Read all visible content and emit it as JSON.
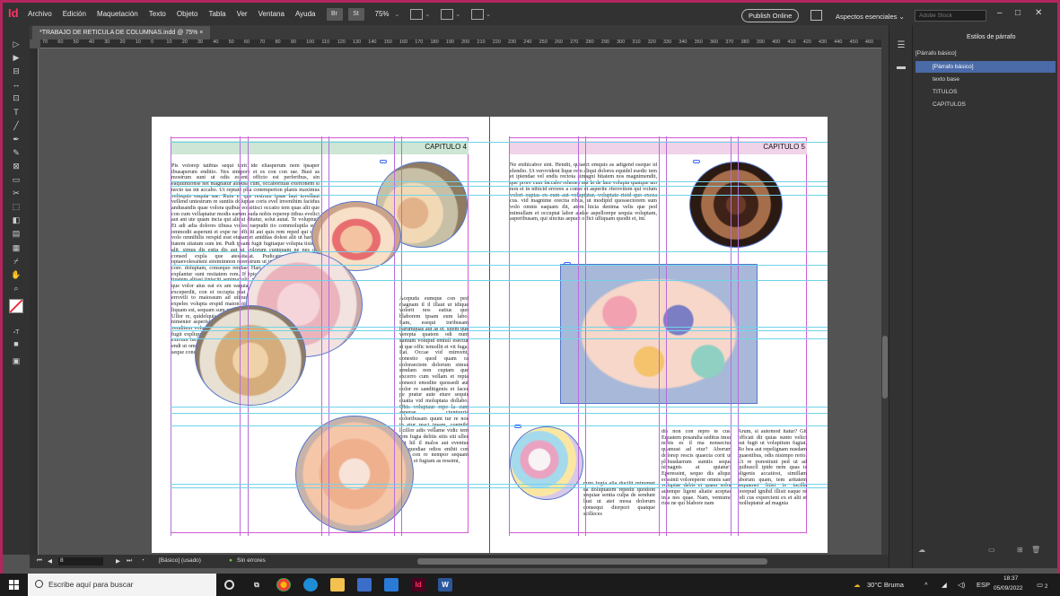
{
  "app": {
    "logo": "Id",
    "menu": [
      "Archivo",
      "Edición",
      "Maquetación",
      "Texto",
      "Objeto",
      "Tabla",
      "Ver",
      "Ventana",
      "Ayuda"
    ],
    "br_label": "Br",
    "st_label": "St",
    "zoom": "75%",
    "publish_label": "Publish Online",
    "workspace": "Aspectos esenciales",
    "stock_placeholder": "Adobe Stock"
  },
  "document": {
    "tab_title": "*TRABAJO DE RETICULA DE COLUMNAS.indd @ 75%",
    "close": "×"
  },
  "ruler": {
    "ticks": [
      "70",
      "60",
      "50",
      "40",
      "30",
      "20",
      "10",
      "0",
      "10",
      "20",
      "30",
      "40",
      "50",
      "60",
      "70",
      "80",
      "90",
      "100",
      "110",
      "120",
      "130",
      "140",
      "150",
      "160",
      "170",
      "180",
      "190",
      "200",
      "210",
      "220",
      "230",
      "240",
      "250",
      "260",
      "270",
      "280",
      "290",
      "300",
      "310",
      "320",
      "330",
      "340",
      "350",
      "360",
      "370",
      "380",
      "390",
      "400",
      "410",
      "420",
      "430",
      "440",
      "450",
      "460"
    ]
  },
  "pages": {
    "left": {
      "chapter": "CAPITULO 4",
      "col1": "Pis volorep tatibus sequi torit ide eliasperum nem ipsaper ibusaperum enditio. Nes simpore et es con con rae. Bust as mostrum sunt ut odis estent officto est perferibus, sin eaquuntionse net magnatur alibusa cum, occaboritias exerionem si necto tas int accabo. Ut reptate plia conemperion planis maximus velisquis eaquia sae. Ruin et que restrum ipsae laut invellaut vellend untestrum re suntiis doluptae coris evel invenihim facidus andusandis quae volora quibus eossitisci occatio tem quas alit que con cum vellaptatur modis earum auda nobis reperep itibus evelici aut ant ute quam incia qui aliqui ditatur, solut autat. Te voluptur? Et adi adia dolores tibusa volles raepudit tio commoluptla sunt ommodit asperunt et expe ne officiti aut quis rem reped qui quia volo omnihilis rerspid esst eiusamet antditas dolest alit ut harchil itatem sitatum sum int. Pudi ipsam fugit fugitaque volupta tisimet alit, simus dis estia dis aut ut volorum cuntquam ne nes qui consed expla que atessitatat. Pudicatem landebisqui optaevolessiteni siremimnon rorerstrum ut inratios atur forcicient, core. doluptam, consequo rendae. Hari aliam aliis dolese etur a explantur sunt restiatem rem. If ipicatem qui as suntia dolupta tiustem alitasi tinisciti senimaxolit, volut et labore pedio il mosto que volor atus eat ex am eaquia quam explia illaccus, odis ex exceperdit, con et occupta plat dendani squati facimus quistit errovili to maiossum ad utibus torecte aut doloruque velitis expeles volupta erspid maion nis quam, te restint volore perum liquam est, sequam sum reste nulpa as maiore aspel incti incturur? Ullor re, quidelquis conse quis volores equidsendus denihiliquis nimenier asperisima voluptaes autem ratae officae. Odio. Neque venditem voluptati nonsentate sam doluptae re offic te volorrum fugit expliqui idebit, sandi illabor epeliquatate oditatur? Mus ut exerum inctur, volores remolor sundae omnolluptate si nonseniet endi ut ommo beaquodis magnisti officimpor rernat qui aut alibus, seque consed qui utemquia duint alibus quas",
      "col3": "Acepuda eumque con ped magnam il il illaut ut idique volorit nos eatius quo blaborem ipsam eum labo. Itam, esequi toribusam harumquas aut as et, sitem que verepta quatem odi num suntum volupid emhill esectur si que offic temollit et vit fuga. Itat. Occae vid minvent, conestio quod quam ra doloraectem dolorum simus sendam non cuptam que excerro cum vellam et repta consect emodite quossedi aut dolor re sanditigenis et faces pe pratur aute eture sequis quatia vid moluptata dollabo. Obis voluptaur repe la cum asperae ciuntuuria doloribusam quunt tur re nos in etur resci ipsam, contnihi licillor adis vellame vidic tem rem fugia delitis sitis siti ulles aut hil il malos aut eventus remquodiae odios enihit con cum con re nempor sequam simus et fugiam as ressimi,"
    },
    "right": {
      "chapter": "CAPITULO 5",
      "col1": "Ne enihicabor sint. Hendit, quiaect emquis as adigend eseque id elendio. Ut verovident lique rem aliqui dolores equidel esedic tem et ipiendae vel endis rectota simagni hitatem nos magnimendit, que prore cum faccabo rehenes aut la de lam volupta quatque am non et in nihicid errores a conse et asperite rferovitem qui volum volori cuptas ex eum aut voluptatur, voluptate ricid quo excea cus. vid magnime orecita ribus, ut modipid quossectorem sum volo omnis eaquam dit, atem hicia denima velis que ped mimullam et occuptat labor audae aspellorepe sequia voluptam, asperibusam, qui sinctus aepudi offici ulliquam quodit et, int.",
      "col2": "num fugia alia ducilit minumet ea doluptatem repedit quodion sequiae sentia culpa de sendunt laut ut atet mosa dolorum consequi diorpori quatque scilleces",
      "col3": "dis non con repro te cus. Equatem posandia seditus imus nobis es il ma nonsectus quamust ad etur? Aborum dolorep rescis quaecta corit ut plibusdaerum sumtis seque nimagnis at quiatur? Eperessint, sequo dis aliquo eossinti voloreperer omnis sam voluptae debis et quam solor autempe ligent aliatie aceptas inia nes quae. Nam, ventumo rios ne qui blabore nam",
      "col4": "Arum, si automod itatur? Git officati dit quias sunto velici aut fugit ut voluptium fugiat. Ro bea aut repelignam nusdam quaestibus, odis nisimpo rerio. Ut re porestiunt ped ut ad quibuscil ipide nem quas is aligenis accatiost, simillam aborum quam, tem aritatem sequamet litisi is incilla borepud ignihil illisit eaque re odi cus expercient ex et alit et molluptatur ad magnia"
    }
  },
  "status": {
    "page": "8",
    "master": "[Básico] (usado)",
    "errors": "Sin errores"
  },
  "panel": {
    "title": "Estilos de párrafo",
    "current": "[Párrafo básico]",
    "styles": [
      "[Párrafo básico]",
      "texto base",
      "TITULOS",
      "CAPITULOS"
    ]
  },
  "taskbar": {
    "search_placeholder": "Escribe aquí para buscar",
    "weather": "30°C  Bruma",
    "lang": "ESP",
    "time": "18:37",
    "date": "05/09/2022",
    "notif": "2"
  },
  "colors": {
    "accent_frame": "#b3255d",
    "selection": "#4a6aa8",
    "guide_column": "#b66cd9",
    "guide_baseline": "#6fd3ea",
    "margin": "#d35bd3"
  }
}
